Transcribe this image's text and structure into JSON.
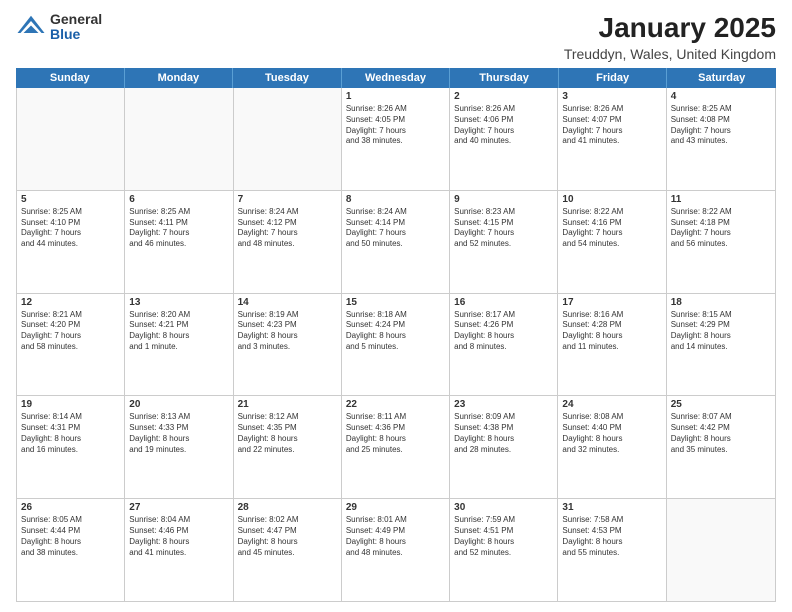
{
  "logo": {
    "general": "General",
    "blue": "Blue"
  },
  "header": {
    "title": "January 2025",
    "subtitle": "Treuddyn, Wales, United Kingdom"
  },
  "weekdays": [
    "Sunday",
    "Monday",
    "Tuesday",
    "Wednesday",
    "Thursday",
    "Friday",
    "Saturday"
  ],
  "rows": [
    [
      {
        "day": "",
        "text": "",
        "empty": true
      },
      {
        "day": "",
        "text": "",
        "empty": true
      },
      {
        "day": "",
        "text": "",
        "empty": true
      },
      {
        "day": "1",
        "text": "Sunrise: 8:26 AM\nSunset: 4:05 PM\nDaylight: 7 hours\nand 38 minutes."
      },
      {
        "day": "2",
        "text": "Sunrise: 8:26 AM\nSunset: 4:06 PM\nDaylight: 7 hours\nand 40 minutes."
      },
      {
        "day": "3",
        "text": "Sunrise: 8:26 AM\nSunset: 4:07 PM\nDaylight: 7 hours\nand 41 minutes."
      },
      {
        "day": "4",
        "text": "Sunrise: 8:25 AM\nSunset: 4:08 PM\nDaylight: 7 hours\nand 43 minutes."
      }
    ],
    [
      {
        "day": "5",
        "text": "Sunrise: 8:25 AM\nSunset: 4:10 PM\nDaylight: 7 hours\nand 44 minutes."
      },
      {
        "day": "6",
        "text": "Sunrise: 8:25 AM\nSunset: 4:11 PM\nDaylight: 7 hours\nand 46 minutes."
      },
      {
        "day": "7",
        "text": "Sunrise: 8:24 AM\nSunset: 4:12 PM\nDaylight: 7 hours\nand 48 minutes."
      },
      {
        "day": "8",
        "text": "Sunrise: 8:24 AM\nSunset: 4:14 PM\nDaylight: 7 hours\nand 50 minutes."
      },
      {
        "day": "9",
        "text": "Sunrise: 8:23 AM\nSunset: 4:15 PM\nDaylight: 7 hours\nand 52 minutes."
      },
      {
        "day": "10",
        "text": "Sunrise: 8:22 AM\nSunset: 4:16 PM\nDaylight: 7 hours\nand 54 minutes."
      },
      {
        "day": "11",
        "text": "Sunrise: 8:22 AM\nSunset: 4:18 PM\nDaylight: 7 hours\nand 56 minutes."
      }
    ],
    [
      {
        "day": "12",
        "text": "Sunrise: 8:21 AM\nSunset: 4:20 PM\nDaylight: 7 hours\nand 58 minutes."
      },
      {
        "day": "13",
        "text": "Sunrise: 8:20 AM\nSunset: 4:21 PM\nDaylight: 8 hours\nand 1 minute."
      },
      {
        "day": "14",
        "text": "Sunrise: 8:19 AM\nSunset: 4:23 PM\nDaylight: 8 hours\nand 3 minutes."
      },
      {
        "day": "15",
        "text": "Sunrise: 8:18 AM\nSunset: 4:24 PM\nDaylight: 8 hours\nand 5 minutes."
      },
      {
        "day": "16",
        "text": "Sunrise: 8:17 AM\nSunset: 4:26 PM\nDaylight: 8 hours\nand 8 minutes."
      },
      {
        "day": "17",
        "text": "Sunrise: 8:16 AM\nSunset: 4:28 PM\nDaylight: 8 hours\nand 11 minutes."
      },
      {
        "day": "18",
        "text": "Sunrise: 8:15 AM\nSunset: 4:29 PM\nDaylight: 8 hours\nand 14 minutes."
      }
    ],
    [
      {
        "day": "19",
        "text": "Sunrise: 8:14 AM\nSunset: 4:31 PM\nDaylight: 8 hours\nand 16 minutes."
      },
      {
        "day": "20",
        "text": "Sunrise: 8:13 AM\nSunset: 4:33 PM\nDaylight: 8 hours\nand 19 minutes."
      },
      {
        "day": "21",
        "text": "Sunrise: 8:12 AM\nSunset: 4:35 PM\nDaylight: 8 hours\nand 22 minutes."
      },
      {
        "day": "22",
        "text": "Sunrise: 8:11 AM\nSunset: 4:36 PM\nDaylight: 8 hours\nand 25 minutes."
      },
      {
        "day": "23",
        "text": "Sunrise: 8:09 AM\nSunset: 4:38 PM\nDaylight: 8 hours\nand 28 minutes."
      },
      {
        "day": "24",
        "text": "Sunrise: 8:08 AM\nSunset: 4:40 PM\nDaylight: 8 hours\nand 32 minutes."
      },
      {
        "day": "25",
        "text": "Sunrise: 8:07 AM\nSunset: 4:42 PM\nDaylight: 8 hours\nand 35 minutes."
      }
    ],
    [
      {
        "day": "26",
        "text": "Sunrise: 8:05 AM\nSunset: 4:44 PM\nDaylight: 8 hours\nand 38 minutes."
      },
      {
        "day": "27",
        "text": "Sunrise: 8:04 AM\nSunset: 4:46 PM\nDaylight: 8 hours\nand 41 minutes."
      },
      {
        "day": "28",
        "text": "Sunrise: 8:02 AM\nSunset: 4:47 PM\nDaylight: 8 hours\nand 45 minutes."
      },
      {
        "day": "29",
        "text": "Sunrise: 8:01 AM\nSunset: 4:49 PM\nDaylight: 8 hours\nand 48 minutes."
      },
      {
        "day": "30",
        "text": "Sunrise: 7:59 AM\nSunset: 4:51 PM\nDaylight: 8 hours\nand 52 minutes."
      },
      {
        "day": "31",
        "text": "Sunrise: 7:58 AM\nSunset: 4:53 PM\nDaylight: 8 hours\nand 55 minutes."
      },
      {
        "day": "",
        "text": "",
        "empty": true
      }
    ]
  ]
}
